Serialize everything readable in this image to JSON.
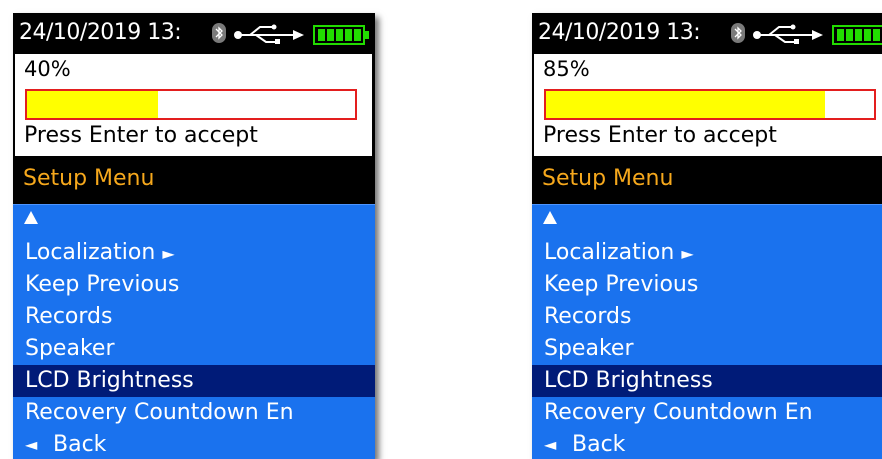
{
  "screens": [
    {
      "status": {
        "datetime": "24/10/2019  13:",
        "bluetooth_icon": "bluetooth-icon",
        "usb_icon": "usb-icon",
        "battery_icon": "battery-full-icon"
      },
      "popup": {
        "percent_text": "40%",
        "progress": 0.4,
        "hint": "Press Enter to accept"
      },
      "menu": {
        "title": "Setup Menu",
        "scroll_up_icon": "triangle-up-icon",
        "items": [
          "Localization",
          "Keep Previous",
          "Records",
          "Speaker",
          "LCD Brightness",
          "Recovery Countdown En"
        ],
        "localization_arrow": "►",
        "back_arrow": "◄",
        "back_label": "Back",
        "selected": "LCD Brightness"
      }
    },
    {
      "status": {
        "datetime": "24/10/2019  13:",
        "bluetooth_icon": "bluetooth-icon",
        "usb_icon": "usb-icon",
        "battery_icon": "battery-full-icon"
      },
      "popup": {
        "percent_text": "85%",
        "progress": 0.85,
        "hint": "Press Enter to accept"
      },
      "menu": {
        "title": "Setup Menu",
        "scroll_up_icon": "triangle-up-icon",
        "items": [
          "Localization",
          "Keep Previous",
          "Records",
          "Speaker",
          "LCD Brightness",
          "Recovery Countdown En"
        ],
        "localization_arrow": "►",
        "back_arrow": "◄",
        "back_label": "Back",
        "selected": "LCD Brightness"
      }
    }
  ],
  "colors": {
    "menu_background": "#1a72ee",
    "selected_background": "#001b78",
    "title_text": "#f6a81c",
    "progress_fill": "#ffff00",
    "progress_border": "#e31e1e",
    "battery_green": "#22dd00"
  }
}
